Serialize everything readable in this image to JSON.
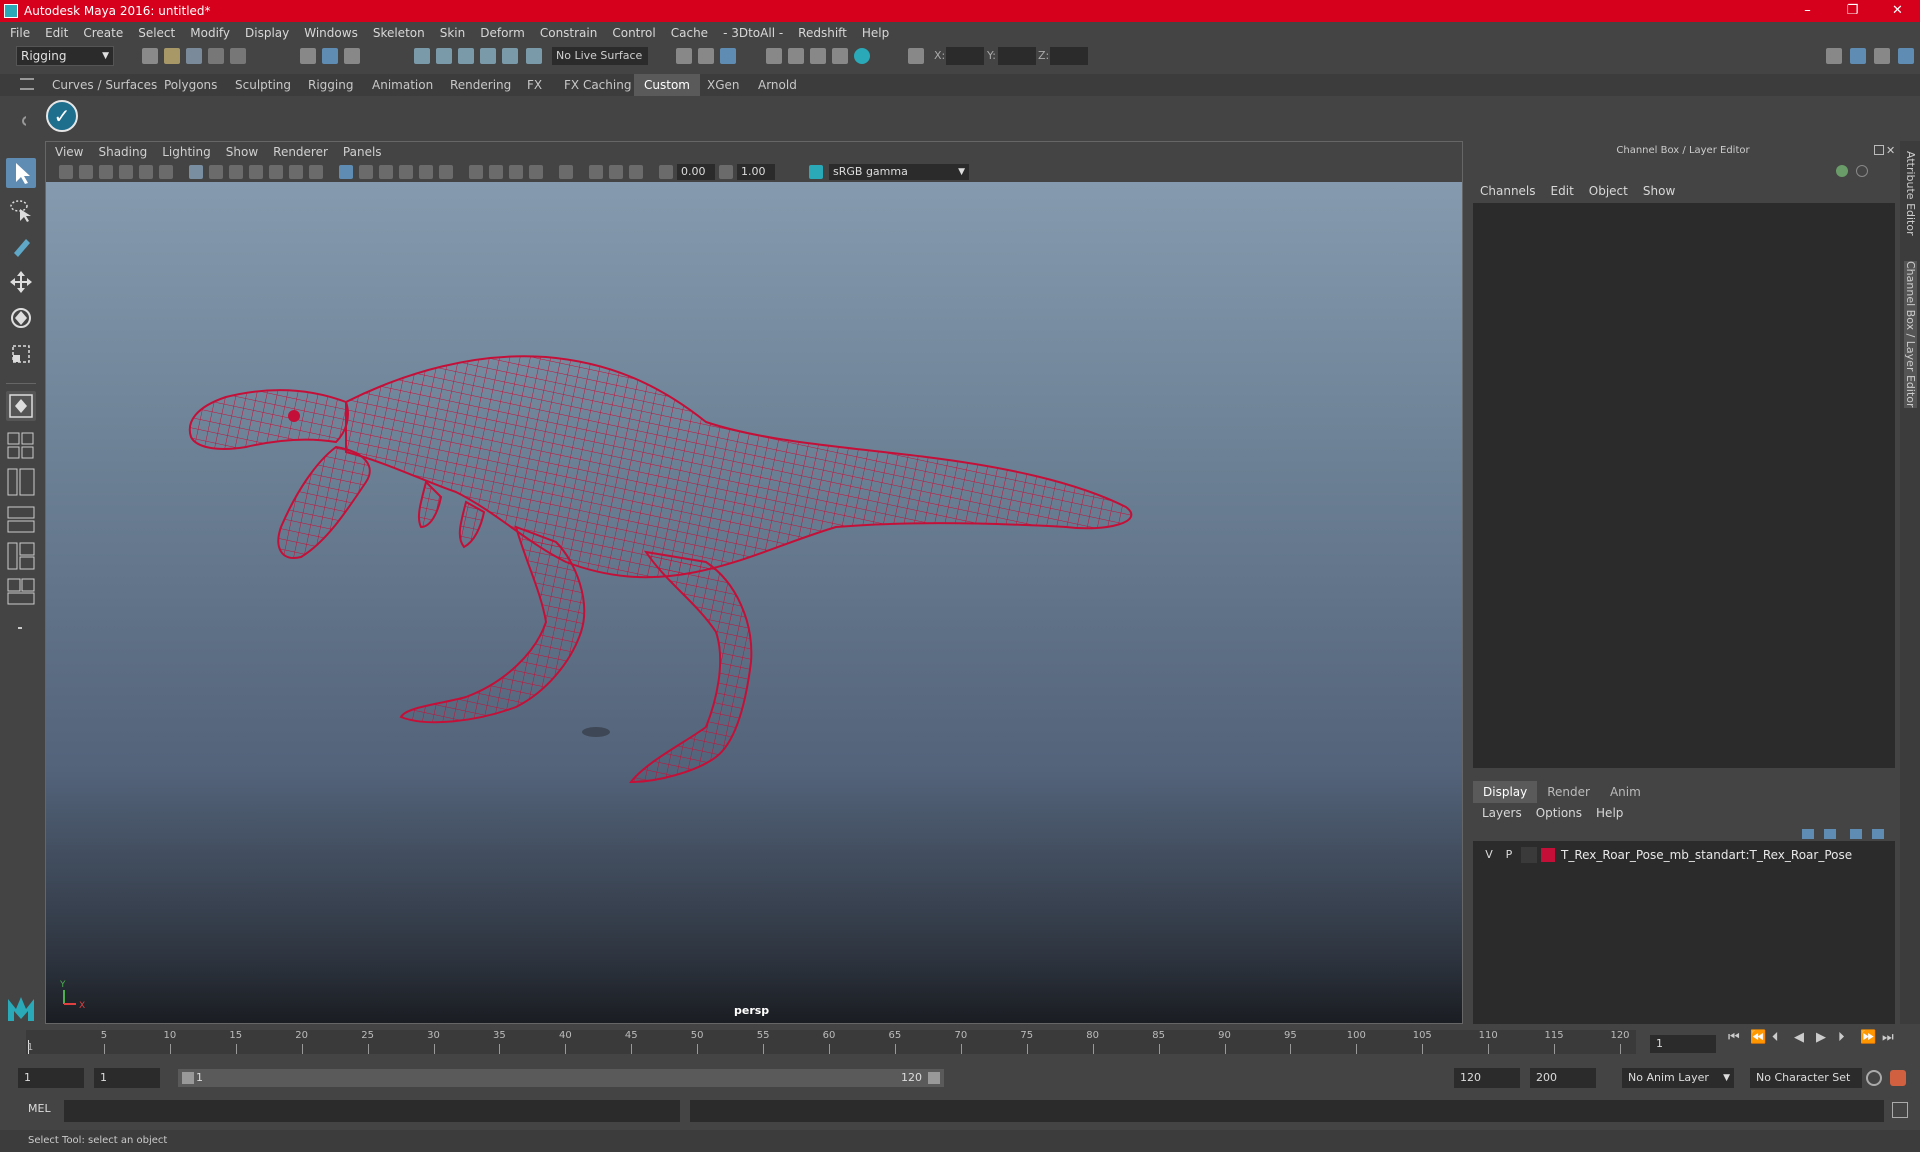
{
  "window": {
    "title": "Autodesk Maya 2016: untitled*",
    "controls": [
      "–",
      "❐",
      "✕"
    ]
  },
  "menubar": [
    "File",
    "Edit",
    "Create",
    "Select",
    "Modify",
    "Display",
    "Windows",
    "Skeleton",
    "Skin",
    "Deform",
    "Constrain",
    "Control",
    "Cache",
    "- 3DtoAll -",
    "Redshift",
    "Help"
  ],
  "statusline": {
    "mode": "Rigging",
    "live_surface": "No Live Surface",
    "x_label": "X:",
    "y_label": "Y:",
    "z_label": "Z:"
  },
  "shelf": {
    "tabs": [
      "Curves / Surfaces",
      "Polygons",
      "Sculpting",
      "Rigging",
      "Animation",
      "Rendering",
      "FX",
      "FX Caching",
      "Custom",
      "XGen",
      "Arnold"
    ],
    "active_tab": "Custom"
  },
  "viewport": {
    "menus": [
      "View",
      "Shading",
      "Lighting",
      "Show",
      "Renderer",
      "Panels"
    ],
    "exposure": "0.00",
    "gamma": "1.00",
    "color_space": "sRGB gamma",
    "camera": "persp",
    "axis_y": "Y",
    "axis_x": "X"
  },
  "channelbox": {
    "title": "Channel Box / Layer Editor",
    "menus": [
      "Channels",
      "Edit",
      "Object",
      "Show"
    ],
    "layer_tabs": [
      "Display",
      "Render",
      "Anim"
    ],
    "layer_menus": [
      "Layers",
      "Options",
      "Help"
    ],
    "layer": {
      "v": "V",
      "p": "P",
      "name": "T_Rex_Roar_Pose_mb_standart:T_Rex_Roar_Pose",
      "color": "#c41038"
    }
  },
  "side_tabs": [
    "Attribute Editor",
    "Channel Box / Layer Editor"
  ],
  "timeslider": {
    "ticks": [
      "5",
      "10",
      "15",
      "20",
      "25",
      "30",
      "35",
      "40",
      "45",
      "50",
      "55",
      "60",
      "65",
      "70",
      "75",
      "80",
      "85",
      "90",
      "95",
      "100",
      "105",
      "110",
      "115",
      "120"
    ],
    "first_tick": "1",
    "current_frame": "1"
  },
  "range": {
    "start": "1",
    "playback_start": "1",
    "slider_start": "1",
    "slider_end": "120",
    "playback_end": "120",
    "end": "200",
    "anim_layer": "No Anim Layer",
    "character_set": "No Character Set"
  },
  "cmdline": {
    "lang": "MEL"
  },
  "helpline": "Select Tool: select an object",
  "colors": {
    "titlebar": "#d6001c",
    "wireframe": "#c41038",
    "active_tool": "#5f8cb3"
  }
}
